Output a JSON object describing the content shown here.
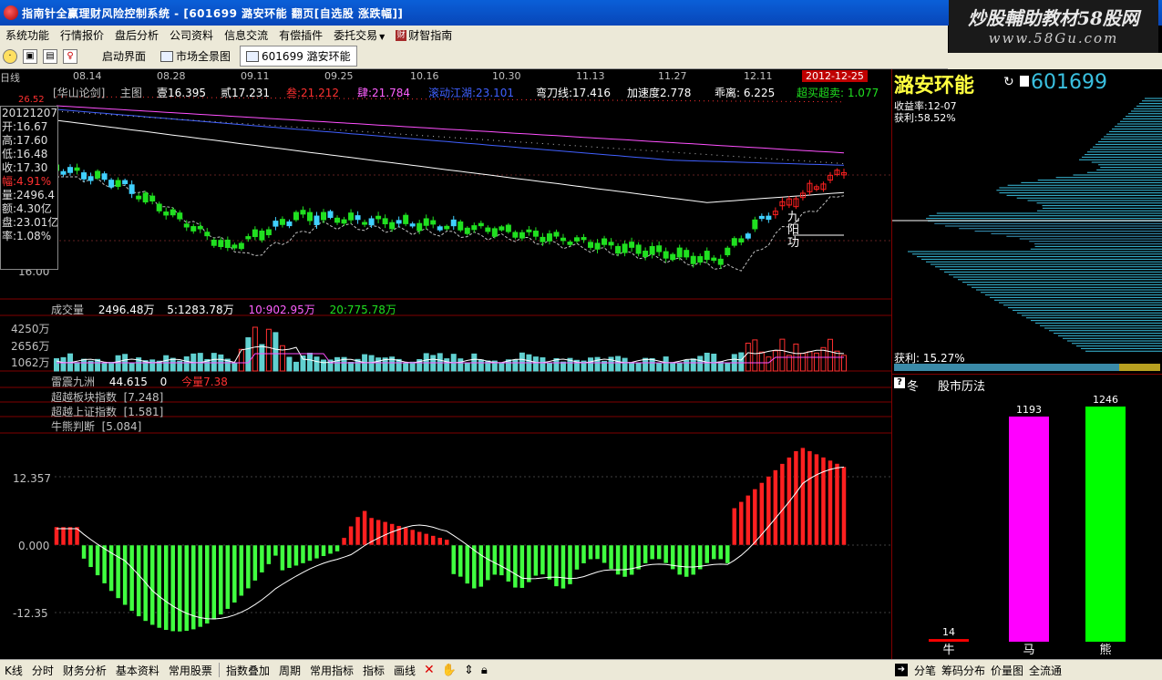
{
  "window": {
    "title": "指南针全赢理财风险控制系统 - [601699 潞安环能 翻页[自选股 涨跌幅]]"
  },
  "watermark": {
    "line1": "炒股輔助教材58股网",
    "line2": "www.58Gu.com"
  },
  "menu": {
    "items": [
      "系统功能",
      "行情报价",
      "盘后分析",
      "公司资料",
      "信息交流",
      "有偿插件",
      "委托交易",
      "财智指南"
    ]
  },
  "toolbar": {
    "start_label": "启动界面",
    "market_label": "市场全景图",
    "stock_tab_label": "601699 潞安环能"
  },
  "chart": {
    "period_label": "日线",
    "dates": [
      "08.14",
      "08.28",
      "09.11",
      "09.25",
      "10.16",
      "10.30",
      "11.13",
      "11.27",
      "12.11"
    ],
    "current_date": "2012-12-25",
    "indicator_line": {
      "name": "[华山论剑]",
      "main": "主图",
      "v1": "壹16.395",
      "v2": "贰17.231",
      "v3": "叁:21.212",
      "v4": "肆:21.784",
      "v5": "滚动江湖:23.101",
      "v6": "弯刀线:17.416",
      "v7": "加速度2.778",
      "v8": "乖离: 6.225",
      "v9": "超买超卖: 1.077"
    },
    "info_box": {
      "date": "20121207",
      "open": "开:16.67",
      "high": "高:17.60",
      "low": "低:16.48",
      "close": "收:17.30",
      "change": "幅:4.91%",
      "volume": "量:2496.4",
      "amount": "额:4.30亿",
      "float": "盘:23.01亿",
      "turnover": "率:1.08%"
    },
    "price_axis": {
      "top": "26.52",
      "bottom": "16.00"
    },
    "annotation": [
      "九",
      "阳",
      "功"
    ],
    "volume": {
      "label": "成交量",
      "value": "2496.48万",
      "ma5": "5:1283.78万",
      "ma10": "10:902.95万",
      "ma20": "20:775.78万",
      "ticks": [
        "4250万",
        "2656万",
        "1062万"
      ]
    },
    "thunder": {
      "name": "雷震九洲",
      "value": "44.615",
      "zero": "0",
      "today": "今量7.38",
      "row2": "超越板块指数  [7.248]",
      "row3": "超越上证指数  [1.581]",
      "row4": "牛熊判断  [5.084]",
      "ticks": [
        "12.357",
        "0.000",
        "-12.35"
      ]
    }
  },
  "right_panel": {
    "stock_name": "潞安环能",
    "stock_code": "601699",
    "small_lines": [
      "收益率:12-07",
      "获利:58.52%"
    ],
    "profit": "获利: 15.27%",
    "history_icon": "?",
    "season": "冬",
    "history_title": "股市历法",
    "bars": {
      "bull": {
        "label": "牛",
        "value": "14"
      },
      "horse": {
        "label": "马",
        "value": "1193"
      },
      "bear": {
        "label": "熊",
        "value": "1246"
      }
    },
    "colors": {
      "horse": "#ff00ff",
      "bear": "#00ff00",
      "bull": "#ff0000"
    }
  },
  "bottom_bar": {
    "items": [
      "K线",
      "分时",
      "财务分析",
      "基本资料",
      "常用股票"
    ],
    "items2": [
      "指数叠加",
      "周期",
      "常用指标",
      "指标",
      "画线"
    ],
    "right_items": [
      "分笔",
      "筹码分布",
      "价量图",
      "全流通"
    ]
  }
}
